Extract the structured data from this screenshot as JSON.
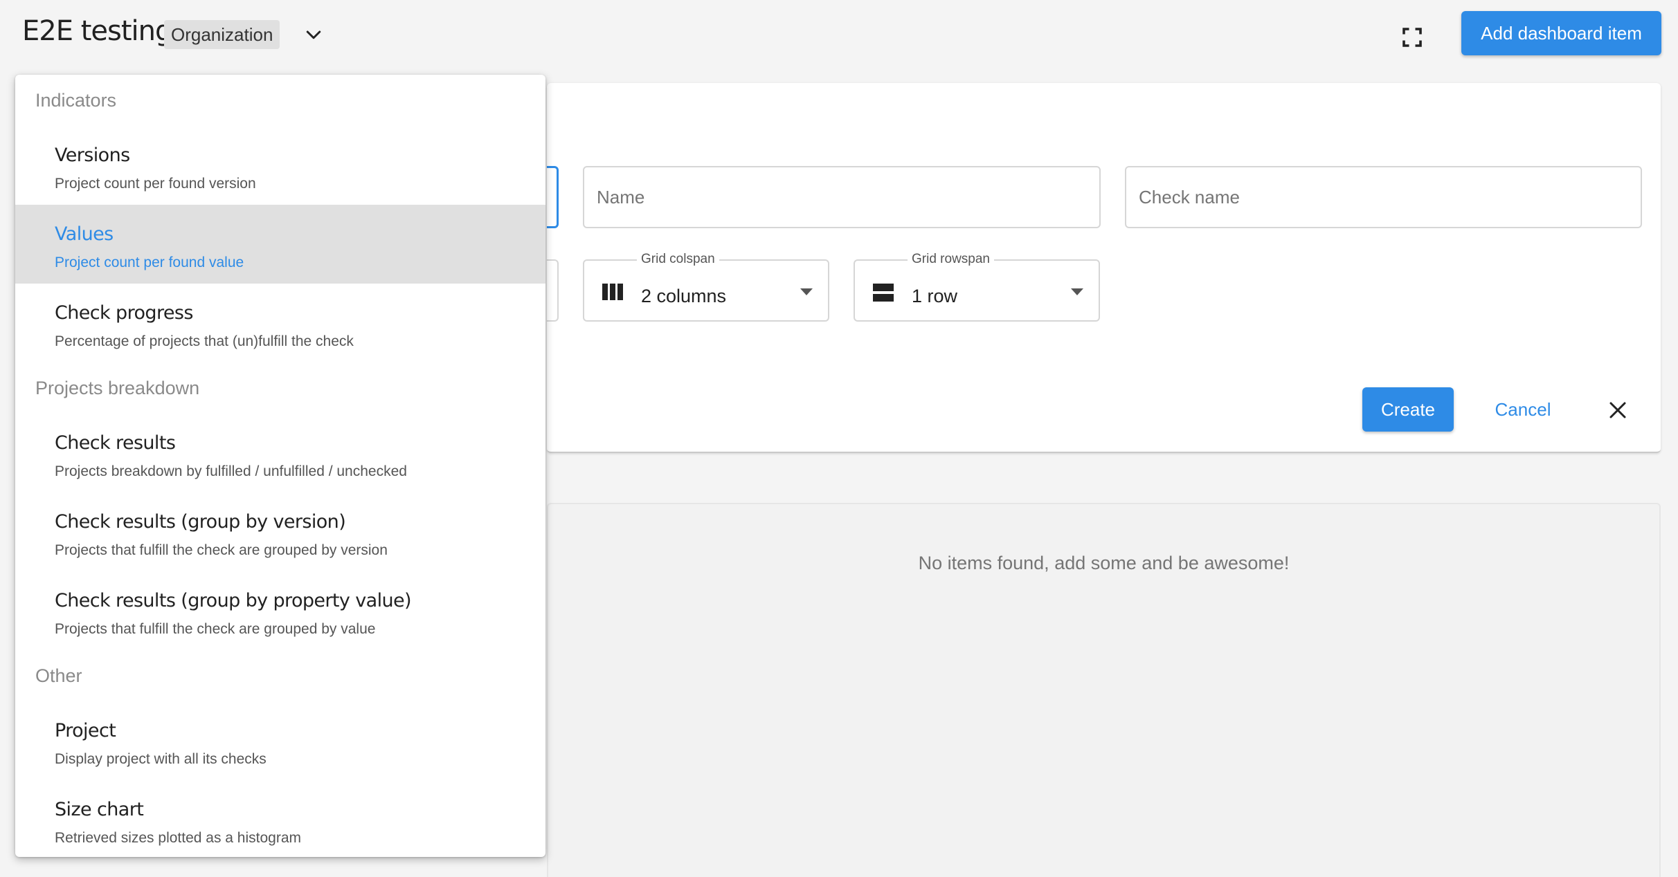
{
  "header": {
    "title": "E2E testing",
    "org_chip": "Organization",
    "add_button": "Add dashboard item"
  },
  "form": {
    "name_placeholder": "Name",
    "check_name_placeholder": "Check name",
    "grid_colspan": {
      "label": "Grid colspan",
      "value": "2 columns"
    },
    "grid_rowspan": {
      "label": "Grid rowspan",
      "value": "1 row"
    },
    "create_label": "Create",
    "cancel_label": "Cancel"
  },
  "empty_message": "No items found, add some and be awesome!",
  "menu": {
    "groups": [
      {
        "label": "Indicators",
        "items": [
          {
            "title": "Versions",
            "desc": "Project count per found version"
          },
          {
            "title": "Values",
            "desc": "Project count per found value",
            "selected": true
          },
          {
            "title": "Check progress",
            "desc": "Percentage of projects that (un)fulfill the check"
          }
        ]
      },
      {
        "label": "Projects breakdown",
        "items": [
          {
            "title": "Check results",
            "desc": "Projects breakdown by fulfilled / unfulfilled / unchecked"
          },
          {
            "title": "Check results (group by version)",
            "desc": "Projects that fulfill the check are grouped by version"
          },
          {
            "title": "Check results (group by property value)",
            "desc": "Projects that fulfill the check are grouped by value"
          }
        ]
      },
      {
        "label": "Other",
        "items": [
          {
            "title": "Project",
            "desc": "Display project with all its checks"
          },
          {
            "title": "Size chart",
            "desc": "Retrieved sizes plotted as a histogram"
          }
        ]
      }
    ]
  },
  "colors": {
    "accent": "#2e8be6",
    "selected_bg": "#e0e0e0"
  },
  "icons": {
    "header_chevron": "chevron-down-icon",
    "fullscreen": "fullscreen-icon",
    "colspan": "view-column-icon",
    "rowspan": "view-row-icon",
    "close": "close-icon"
  }
}
